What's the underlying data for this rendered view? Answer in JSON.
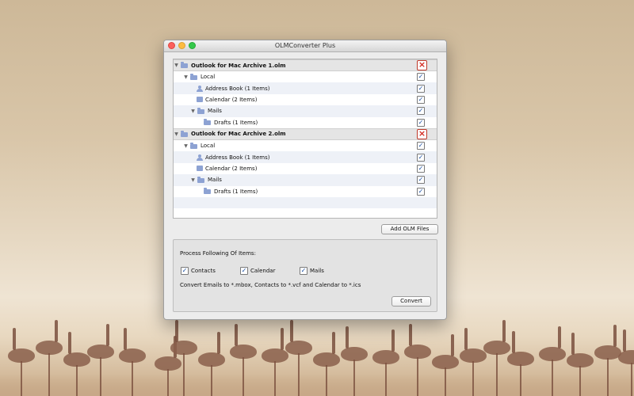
{
  "window": {
    "title": "OLMConverter Plus"
  },
  "tree": {
    "archives": [
      {
        "name": "Outlook for Mac Archive 1.olm",
        "local": "Local",
        "address_book": "Address Book (1 Items)",
        "calendar": "Calendar (2 Items)",
        "mails": "Mails",
        "drafts": "Drafts (1 Items)"
      },
      {
        "name": "Outlook for Mac Archive 2.olm",
        "local": "Local",
        "address_book": "Address Book (1 Items)",
        "calendar": "Calendar (2 Items)",
        "mails": "Mails",
        "drafts": "Drafts (1 Items)"
      }
    ],
    "remove_icon": "close-x-icon",
    "check_glyph": "✓"
  },
  "buttons": {
    "add_olm": "Add OLM Files",
    "convert": "Convert"
  },
  "process": {
    "heading": "Process Following Of Items:",
    "options": [
      {
        "label": "Contacts",
        "checked": true
      },
      {
        "label": "Calendar",
        "checked": true
      },
      {
        "label": "Mails",
        "checked": true
      }
    ],
    "description": "Convert Emails to *.mbox, Contacts to *.vcf and Calendar to *.ics"
  },
  "colors": {
    "accent": "#1a4fa3",
    "remove": "#d3281f",
    "folder": "#8da2d3"
  }
}
